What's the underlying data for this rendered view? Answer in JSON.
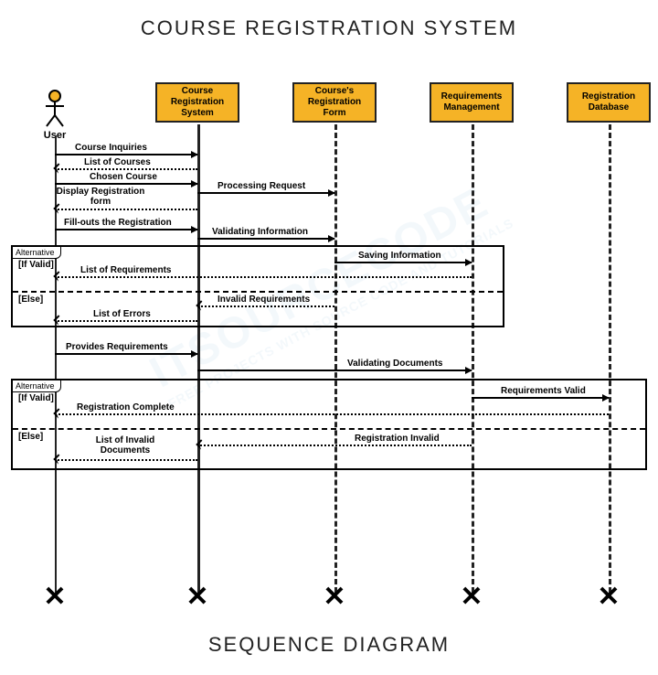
{
  "title": "COURSE REGISTRATION SYSTEM",
  "footer": "SEQUENCE DIAGRAM",
  "watermark": {
    "main": "ITSOURCECODE",
    "sub": "FREE PROJECTS WITH SOURCE CODE AND TUTORIALS"
  },
  "actor": {
    "label": "User"
  },
  "objects": {
    "crs": "Course Registration System",
    "crf": "Course's Registration Form",
    "rm": "Requirements Management",
    "rd": "Registration Database"
  },
  "messages": {
    "m1": "Course Inquiries",
    "m2": "List of Courses",
    "m3": "Chosen Course",
    "m4": "Processing Request",
    "m5": "Display Registration form",
    "m6": "Fill-outs the Registration",
    "m7": "Validating Information",
    "m8": "Saving Information",
    "m9": "List of Requirements",
    "m10": "Invalid Requirements",
    "m11": "List of Errors",
    "m12": "Provides Requirements",
    "m13": "Validating Documents",
    "m14": "Requirements  Valid",
    "m15": "Registration Complete",
    "m16": "Registration Invalid",
    "m17": "List of Invalid Documents"
  },
  "fragments": {
    "alt1": {
      "label": "Alternative",
      "guard1": "[If Valid]",
      "guard2": "[Else]"
    },
    "alt2": {
      "label": "Alternative",
      "guard1": "[If Valid]",
      "guard2": "[Else]"
    }
  },
  "lifelines_x": {
    "user": 50,
    "crs": 206,
    "crf": 356,
    "rm": 506,
    "rd": 656
  }
}
